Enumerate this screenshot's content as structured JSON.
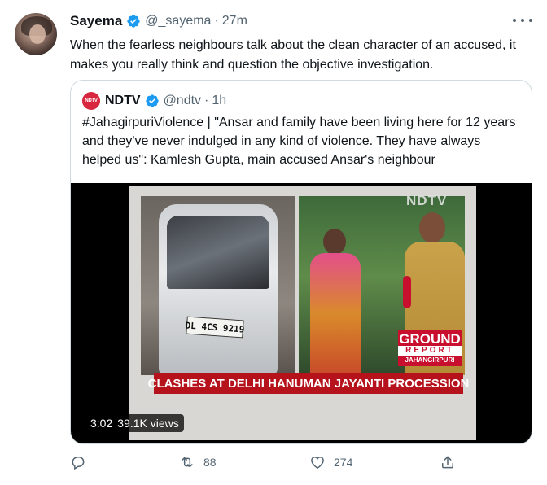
{
  "tweet": {
    "author": {
      "name": "Sayema",
      "handle": "@_sayema",
      "time": "27m",
      "avatar_icon": "profile-avatar",
      "verified_icon": "verified-badge-icon"
    },
    "text": "When the fearless neighbours talk about the clean character of an accused, it makes you really think and question the objective investigation.",
    "more_icon": "more-options-icon"
  },
  "quote": {
    "author": {
      "name": "NDTV",
      "handle": "@ndtv",
      "time": "1h",
      "avatar_text": "NDTV",
      "verified_icon": "verified-badge-icon"
    },
    "text": "#JahagirpuriViolence | \"Ansar and family have been living here for 12 years and they've never indulged in any kind of violence. They have always helped us\": Kamlesh Gupta, main accused Ansar's neighbour",
    "video": {
      "duration": "3:02",
      "views": "39.1K views",
      "watermark": "NDTV",
      "plate": "DL 4CS 9219",
      "badge": {
        "line1": "GROUND",
        "line2": "REPORT",
        "line3": "JAHANGIRPURI"
      },
      "ticker": "CLASHES AT DELHI HANUMAN JAYANTI PROCESSION"
    }
  },
  "actions": {
    "reply": {
      "icon": "reply-icon",
      "count": ""
    },
    "retweet": {
      "icon": "retweet-icon",
      "count": "88"
    },
    "like": {
      "icon": "like-heart-icon",
      "count": "274"
    },
    "share": {
      "icon": "share-icon",
      "count": ""
    }
  },
  "colors": {
    "verified": "#1d9bf0",
    "secondary_text": "#536471",
    "ndtv_red": "#d7263d",
    "ticker_red": "#b5121b"
  }
}
